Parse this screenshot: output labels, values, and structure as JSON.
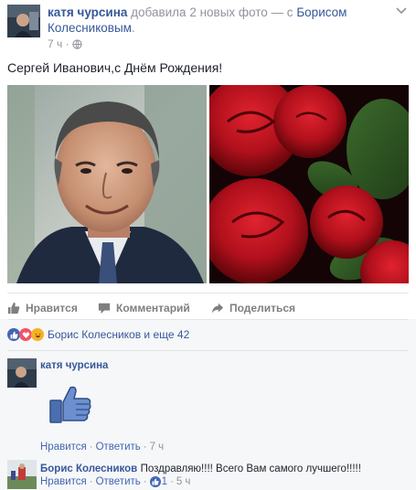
{
  "post": {
    "author": "катя чурсина",
    "action_text": "добавила 2 новых фото —",
    "with_word": "с",
    "tagged_person": "Борисом Колесниковым",
    "period": ".",
    "time": "7 ч",
    "separator": "·",
    "privacy_icon": "globe-icon",
    "text": "Сергей Иванович,с Днём Рождения!",
    "photos": [
      {
        "name": "portrait-photo",
        "description_icon": "man-portrait"
      },
      {
        "name": "roses-photo",
        "description_icon": "red-roses"
      }
    ]
  },
  "actions": {
    "like": "Нравится",
    "comment": "Комментарий",
    "share": "Поделиться"
  },
  "reactions": {
    "icons": [
      "like-reaction-icon",
      "love-reaction-icon",
      "haha-reaction-icon"
    ],
    "summary": "Борис Колесников и еще 42"
  },
  "comments": [
    {
      "author": "катя чурсина",
      "text": "",
      "sticker": "thumbs-up-sticker",
      "like": "Нравится",
      "reply": "Ответить",
      "time": "7 ч",
      "separator": "·"
    },
    {
      "author": "Борис Колесников",
      "text": "Поздравляю!!!! Всего Вам самого лучшего!!!!!",
      "like": "Нравится",
      "reply": "Ответить",
      "like_count": "1",
      "time": "5 ч",
      "separator": "·"
    }
  ],
  "colors": {
    "link": "#365899",
    "meta": "#90949c",
    "like_blue": "#4267b2",
    "love_red": "#f25268",
    "haha_yellow": "#f7b125"
  }
}
